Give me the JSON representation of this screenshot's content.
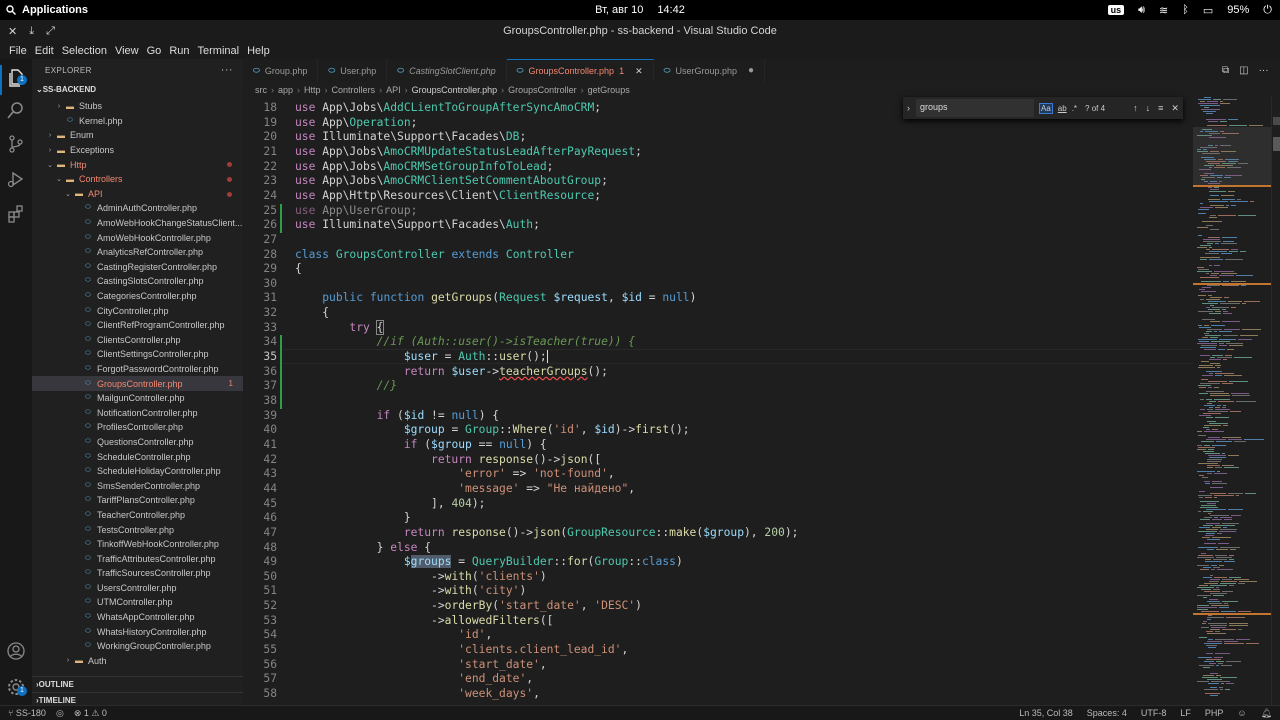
{
  "system": {
    "apps_label": "Applications",
    "date": "Вт, авг 10",
    "time": "14:42",
    "keyboard": "us",
    "battery": "95%"
  },
  "window": {
    "title": "GroupsController.php - ss-backend - Visual Studio Code"
  },
  "menu": [
    "File",
    "Edit",
    "Selection",
    "View",
    "Go",
    "Run",
    "Terminal",
    "Help"
  ],
  "activity": {
    "explorer_badge": "1"
  },
  "sidebar": {
    "header": "EXPLORER",
    "project": "SS-BACKEND",
    "tree": [
      {
        "label": "Stubs",
        "type": "folder",
        "indent": 2,
        "chevron": "›"
      },
      {
        "label": "Kernel.php",
        "type": "php",
        "indent": 2
      },
      {
        "label": "Enum",
        "type": "folder",
        "indent": 1,
        "chevron": "›"
      },
      {
        "label": "Exceptions",
        "type": "folder",
        "indent": 1,
        "chevron": "›"
      },
      {
        "label": "Http",
        "type": "folder",
        "indent": 1,
        "chevron": "⌄",
        "red": true,
        "dot": true
      },
      {
        "label": "Controllers",
        "type": "folder",
        "indent": 2,
        "chevron": "⌄",
        "red": true,
        "dot": true
      },
      {
        "label": "API",
        "type": "folder",
        "indent": 3,
        "chevron": "⌄",
        "red": true,
        "dot": true
      },
      {
        "label": "AdminAuthController.php",
        "type": "php",
        "indent": 4
      },
      {
        "label": "AmoWebHookChangeStatusClient...",
        "type": "php",
        "indent": 4
      },
      {
        "label": "AmoWebHookController.php",
        "type": "php",
        "indent": 4
      },
      {
        "label": "AnalyticsRefController.php",
        "type": "php",
        "indent": 4
      },
      {
        "label": "CastingRegisterController.php",
        "type": "php",
        "indent": 4
      },
      {
        "label": "CastingSlotsController.php",
        "type": "php",
        "indent": 4
      },
      {
        "label": "CategoriesController.php",
        "type": "php",
        "indent": 4
      },
      {
        "label": "CityController.php",
        "type": "php",
        "indent": 4
      },
      {
        "label": "ClientRefProgramController.php",
        "type": "php",
        "indent": 4
      },
      {
        "label": "ClientsController.php",
        "type": "php",
        "indent": 4
      },
      {
        "label": "ClientSettingsController.php",
        "type": "php",
        "indent": 4
      },
      {
        "label": "ForgotPasswordController.php",
        "type": "php",
        "indent": 4
      },
      {
        "label": "GroupsController.php",
        "type": "php",
        "indent": 4,
        "selected": true,
        "red": true,
        "count": "1"
      },
      {
        "label": "MailgunController.php",
        "type": "php",
        "indent": 4
      },
      {
        "label": "NotificationController.php",
        "type": "php",
        "indent": 4
      },
      {
        "label": "ProfilesController.php",
        "type": "php",
        "indent": 4
      },
      {
        "label": "QuestionsController.php",
        "type": "php",
        "indent": 4
      },
      {
        "label": "ScheduleController.php",
        "type": "php",
        "indent": 4
      },
      {
        "label": "ScheduleHolidayController.php",
        "type": "php",
        "indent": 4
      },
      {
        "label": "SmsSenderController.php",
        "type": "php",
        "indent": 4
      },
      {
        "label": "TariffPlansController.php",
        "type": "php",
        "indent": 4
      },
      {
        "label": "TeacherController.php",
        "type": "php",
        "indent": 4
      },
      {
        "label": "TestsController.php",
        "type": "php",
        "indent": 4
      },
      {
        "label": "TinkoffWebHookController.php",
        "type": "php",
        "indent": 4
      },
      {
        "label": "TrafficAttributesController.php",
        "type": "php",
        "indent": 4
      },
      {
        "label": "TrafficSourcesController.php",
        "type": "php",
        "indent": 4
      },
      {
        "label": "UsersController.php",
        "type": "php",
        "indent": 4
      },
      {
        "label": "UTMController.php",
        "type": "php",
        "indent": 4
      },
      {
        "label": "WhatsAppController.php",
        "type": "php",
        "indent": 4
      },
      {
        "label": "WhatsHistoryController.php",
        "type": "php",
        "indent": 4
      },
      {
        "label": "WorkingGroupController.php",
        "type": "php",
        "indent": 4
      },
      {
        "label": "Auth",
        "type": "folder",
        "indent": 3,
        "chevron": "›"
      }
    ],
    "outline": "OUTLINE",
    "timeline": "TIMELINE"
  },
  "tabs": [
    {
      "label": "Group.php",
      "italic": false,
      "active": false
    },
    {
      "label": "User.php",
      "italic": false,
      "active": false
    },
    {
      "label": "CastingSlotClient.php",
      "italic": true,
      "active": false
    },
    {
      "label": "GroupsController.php",
      "badge": "1",
      "active": true
    },
    {
      "label": "UserGroup.php",
      "modified": true,
      "active": false
    }
  ],
  "breadcrumbs": [
    "src",
    "app",
    "Http",
    "Controllers",
    "API",
    "GroupsController.php",
    "GroupsController",
    "getGroups"
  ],
  "find": {
    "query": "groups",
    "result": "? of 4",
    "opt_case": "Aa",
    "opt_word": "ab",
    "opt_regex": ".*"
  },
  "code_lines": [
    {
      "n": 18,
      "html": "<span class='k'>use</span> App\\Jobs\\<span class='t'>AddCLientToGroupAfterSyncAmoCRM</span>;"
    },
    {
      "n": 19,
      "html": "<span class='k'>use</span> App\\<span class='t'>Operation</span>;"
    },
    {
      "n": 20,
      "html": "<span class='k'>use</span> Illuminate\\Support\\Facades\\<span class='t'>DB</span>;"
    },
    {
      "n": 21,
      "html": "<span class='k'>use</span> App\\Jobs\\<span class='t'>AmoCRMUpdateStatusLeadAfterPayRequest</span>;"
    },
    {
      "n": 22,
      "html": "<span class='k'>use</span> App\\Jobs\\<span class='t'>AmoCRMSetGroupInfoToLead</span>;"
    },
    {
      "n": 23,
      "html": "<span class='k'>use</span> App\\Jobs\\<span class='t'>AmoCRMClientSetCommentAboutGroup</span>;"
    },
    {
      "n": 24,
      "html": "<span class='k'>use</span> App\\Http\\Resources\\Client\\<span class='t'>ClientResource</span>;"
    },
    {
      "n": 25,
      "html": "<span class='k' style='opacity:.6'>use</span><span style='opacity:.6'> App\\UserGroup;</span>"
    },
    {
      "n": 26,
      "html": "<span class='k'>use</span> Illuminate\\Support\\Facades\\<span class='t'>Auth</span>;"
    },
    {
      "n": 27,
      "html": ""
    },
    {
      "n": 28,
      "html": "<span class='kw'>class</span> <span class='t'>GroupsController</span> <span class='kw'>extends</span> <span class='t'>Controller</span>"
    },
    {
      "n": 29,
      "html": "{"
    },
    {
      "n": 30,
      "html": ""
    },
    {
      "n": 31,
      "html": "    <span class='kw'>public</span> <span class='kw'>function</span> <span class='f'>getGroups</span>(<span class='t'>Request</span> <span class='v'>$request</span>, <span class='v'>$id</span> = <span class='kw'>null</span>)"
    },
    {
      "n": 32,
      "html": "    {"
    },
    {
      "n": 33,
      "html": "        <span class='k'>try</span> <span style='outline:1px solid #888'>{</span>"
    },
    {
      "n": 34,
      "html": "            <span class='c'>//if (Auth::user()->isTeacher(true)) {</span>"
    },
    {
      "n": 35,
      "html": "                <span class='v'>$user</span> = <span class='t'>Auth</span>::<span class='f'>user</span>();<span style='border-left:1px solid #ddd'></span>"
    },
    {
      "n": 36,
      "html": "                <span class='k'>return</span> <span class='v'>$user</span>-><span class='f' style='text-decoration:underline wavy #f14c4c'>teacherGroups</span>();"
    },
    {
      "n": 37,
      "html": "            <span class='c'>//}</span>"
    },
    {
      "n": 38,
      "html": ""
    },
    {
      "n": 39,
      "html": "            <span class='k'>if</span> (<span class='v'>$id</span> != <span class='kw'>null</span>) {"
    },
    {
      "n": 40,
      "html": "                <span class='v'>$group</span> = <span class='t'>Group</span>::<span class='f'>Where</span>(<span class='s'>'id'</span>, <span class='v'>$id</span>)-><span class='f'>first</span>();"
    },
    {
      "n": 41,
      "html": "                <span class='k'>if</span> (<span class='v'>$group</span> == <span class='kw'>null</span>) {"
    },
    {
      "n": 42,
      "html": "                    <span class='k'>return</span> <span class='f'>response</span>()-><span class='f'>json</span>(["
    },
    {
      "n": 43,
      "html": "                        <span class='s'>'error'</span> => <span class='s'>'not-found'</span>,"
    },
    {
      "n": 44,
      "html": "                        <span class='s'>'message'</span> => <span class='s'>\"Не найдено\"</span>,"
    },
    {
      "n": 45,
      "html": "                    ], <span class='n'>404</span>);"
    },
    {
      "n": 46,
      "html": "                }"
    },
    {
      "n": 47,
      "html": "                <span class='k'>return</span> <span class='f'>response</span>()-><span class='f'>json</span>(<span class='t'>GroupResource</span>::<span class='f'>make</span>(<span class='v'>$group</span>), <span class='n'>200</span>);"
    },
    {
      "n": 48,
      "html": "            } <span class='k'>else</span> {"
    },
    {
      "n": 49,
      "html": "                <span class='v'>$<span style='background:#515c6a'>groups</span></span> = <span class='t'>QueryBuilder</span>::<span class='f'>for</span>(<span class='t'>Group</span>::<span class='kw'>class</span>)"
    },
    {
      "n": 50,
      "html": "                    -><span class='f'>with</span>(<span class='s'>'clients'</span>)"
    },
    {
      "n": 51,
      "html": "                    -><span class='f'>with</span>(<span class='s'>'city'</span>)"
    },
    {
      "n": 52,
      "html": "                    -><span class='f'>orderBy</span>(<span class='s'>'start_date'</span>, <span class='s'>'DESC'</span>)"
    },
    {
      "n": 53,
      "html": "                    -><span class='f'>allowedFilters</span>(["
    },
    {
      "n": 54,
      "html": "                        <span class='s'>'id'</span>,"
    },
    {
      "n": 55,
      "html": "                        <span class='s'>'clients.client_lead_id'</span>,"
    },
    {
      "n": 56,
      "html": "                        <span class='s'>'start_date'</span>,"
    },
    {
      "n": 57,
      "html": "                        <span class='s'>'end_date'</span>,"
    },
    {
      "n": 58,
      "html": "                        <span class='s'>'week_days'</span>,"
    }
  ],
  "current_line": 35,
  "status": {
    "branch": "SS-180",
    "problems": "⊗ 1 ⚠ 0",
    "position": "Ln 35, Col 38",
    "spaces": "Spaces: 4",
    "encoding": "UTF-8",
    "eol": "LF",
    "language": "PHP"
  },
  "colors": {
    "accent": "#0e70c0",
    "error": "#f48771",
    "added": "#2ea043"
  }
}
